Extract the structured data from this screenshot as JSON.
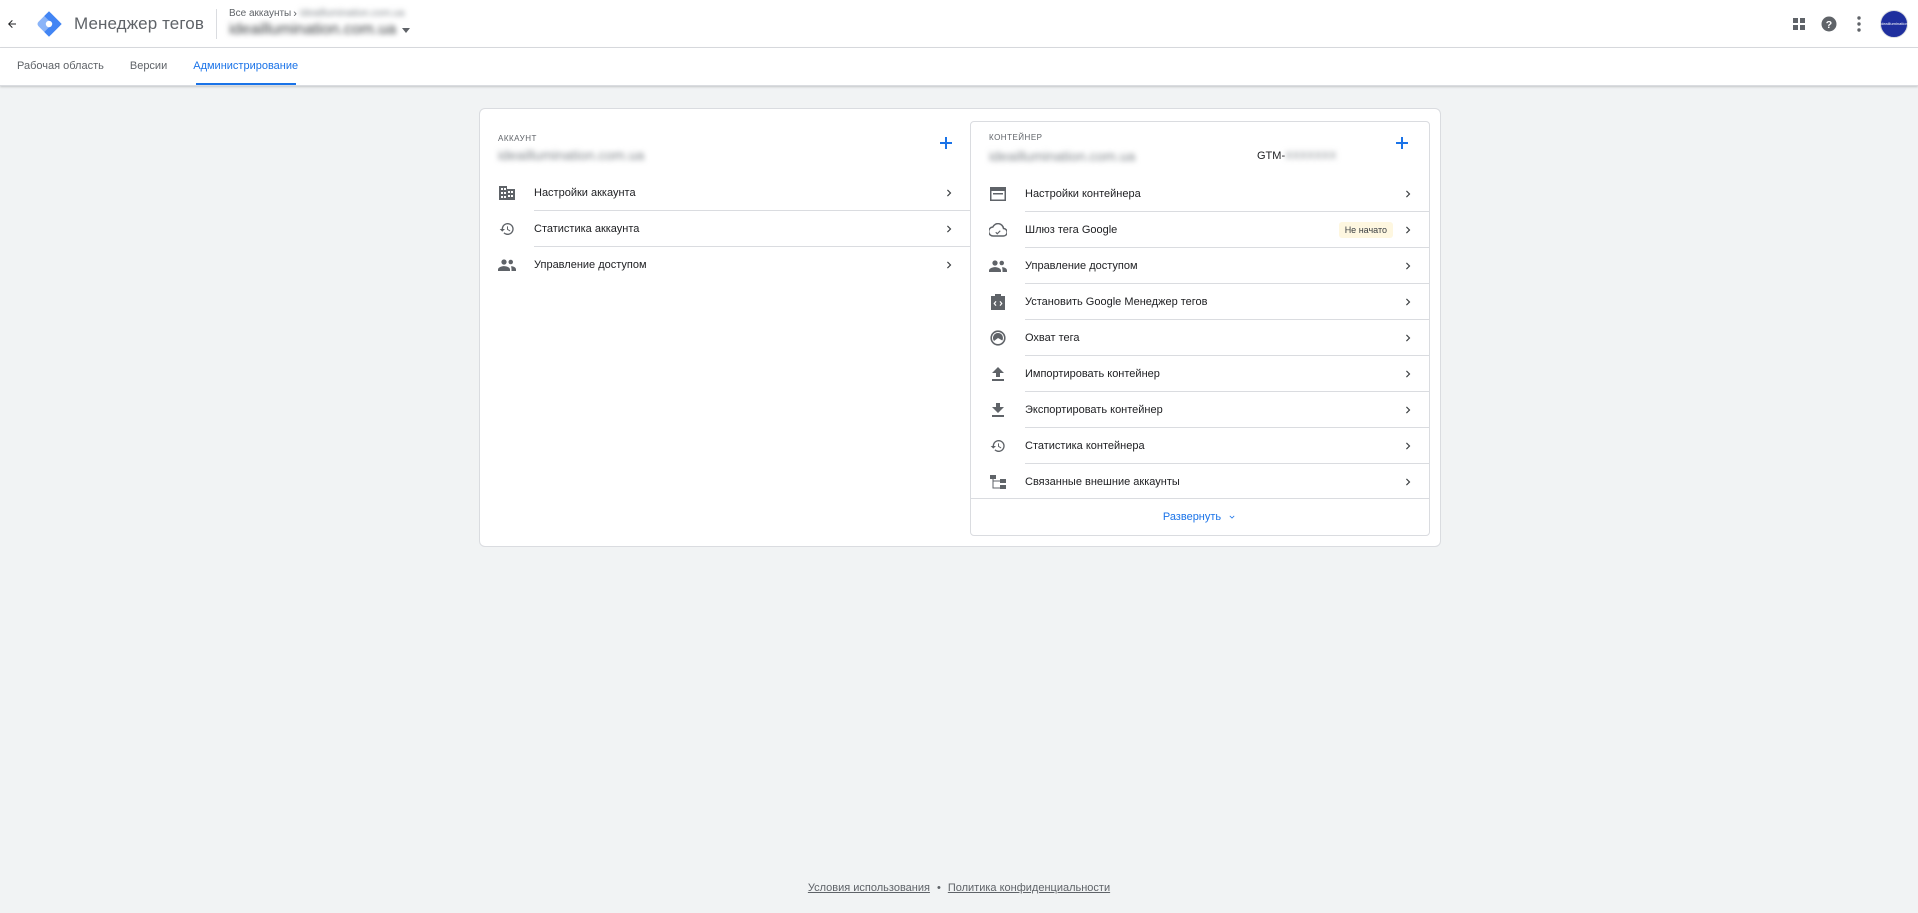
{
  "header": {
    "product_name": "Менеджер тегов",
    "breadcrumb_root": "Все аккаунты",
    "breadcrumb_account": "ideaillumination.com.ua",
    "container_name": "ideaillumination.com.ua",
    "avatar_text": "ideaillumination"
  },
  "tabs": [
    {
      "label": "Рабочая область"
    },
    {
      "label": "Версии"
    },
    {
      "label": "Администрирование"
    }
  ],
  "account": {
    "section_label": "АККАУНТ",
    "name": "ideaillumination.com.ua",
    "items": [
      {
        "label": "Настройки аккаунта",
        "icon": "building-icon"
      },
      {
        "label": "Статистика аккаунта",
        "icon": "history-icon"
      },
      {
        "label": "Управление доступом",
        "icon": "people-icon"
      }
    ]
  },
  "container": {
    "section_label": "КОНТЕЙНЕР",
    "name": "ideaillumination.com.ua",
    "gtm_prefix": "GTM-",
    "gtm_id": "XXXXXXX",
    "items": [
      {
        "label": "Настройки контейнера",
        "icon": "web-icon"
      },
      {
        "label": "Шлюз тега Google",
        "icon": "cloud-icon",
        "badge": "Не начато"
      },
      {
        "label": "Управление доступом",
        "icon": "people-icon"
      },
      {
        "label": "Установить Google Менеджер тегов",
        "icon": "code-icon"
      },
      {
        "label": "Охват тега",
        "icon": "coverage-icon"
      },
      {
        "label": "Импортировать контейнер",
        "icon": "upload-icon"
      },
      {
        "label": "Экспортировать контейнер",
        "icon": "download-icon"
      },
      {
        "label": "Статистика контейнера",
        "icon": "history-icon"
      },
      {
        "label": "Связанные внешние аккаунты",
        "icon": "tree-icon"
      }
    ],
    "expand_label": "Развернуть"
  },
  "footer": {
    "terms": "Условия использования",
    "separator": "•",
    "privacy": "Политика конфиденциальности"
  },
  "colors": {
    "accent": "#1a73e8",
    "badge_bg": "#fef7e0",
    "avatar_bg": "#1f2f9e"
  }
}
